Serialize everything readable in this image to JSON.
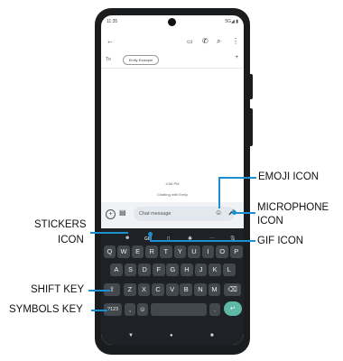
{
  "status_bar": {
    "time": "11:35",
    "icons": "5G◢ ▮"
  },
  "top_bar": {
    "back_icon": "←",
    "video_icon": "▭",
    "call_icon": "✆",
    "search_icon": "⌕",
    "more_icon": "⋮"
  },
  "recipient": {
    "to_label": "To",
    "chip": "Emily Example",
    "add_icon": "+"
  },
  "conversation": {
    "timestamp": "4:56 PM",
    "chatting_with": "Chatting with Emily"
  },
  "compose": {
    "placeholder": "Chat message",
    "add_icon": "+",
    "media_icon": "▤",
    "emoji_icon": "☺",
    "mic_icon": "🎤"
  },
  "keyboard_toolbar": {
    "stickers_icon": "☻",
    "gif_label": "GIF",
    "clipboard_icon": "▯",
    "settings_icon": "✱",
    "more_icon": "···",
    "mic_icon": "🎙"
  },
  "keyboard": {
    "row1": [
      "Q",
      "W",
      "E",
      "R",
      "T",
      "Y",
      "U",
      "I",
      "O",
      "P"
    ],
    "row2": [
      "A",
      "S",
      "D",
      "F",
      "G",
      "H",
      "J",
      "K",
      "L"
    ],
    "row3": [
      "Z",
      "X",
      "C",
      "V",
      "B",
      "N",
      "M"
    ],
    "shift": "⇧",
    "backspace": "⌫",
    "symbols": "?123",
    "comma": ",",
    "emoji": "☺",
    "period": ".",
    "enter": "↵"
  },
  "nav_bar": {
    "back": "▼",
    "home": "●",
    "recents": "■"
  },
  "callouts": {
    "emoji": "EMOJI ICON",
    "microphone_line1": "MICROPHONE",
    "microphone_line2": "ICON",
    "stickers_line1": "STICKERS",
    "stickers_line2": "ICON",
    "gif": "GIF ICON",
    "shift": "SHIFT KEY",
    "symbols": "SYMBOLS KEY"
  },
  "colors": {
    "accent": "#1c8fd1",
    "keyboard_bg": "#1e2226",
    "key_bg": "#42484e",
    "enter_key": "#5fb8a6"
  }
}
